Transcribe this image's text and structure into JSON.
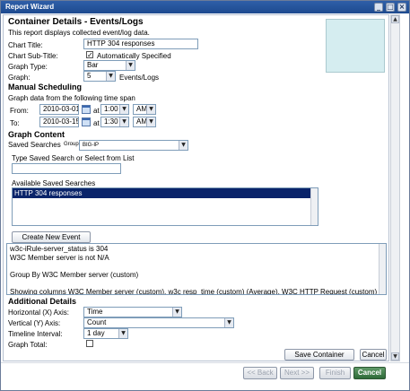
{
  "window": {
    "title": "Report Wizard"
  },
  "container": {
    "heading": "Container Details - Events/Logs",
    "description": "This report displays collected event/log data.",
    "chart_title_label": "Chart Title:",
    "chart_title_value": "HTTP 304 responses",
    "chart_subtitle_label": "Chart Sub-Title:",
    "auto_specified_label": "Automatically Specified",
    "graph_type_label": "Graph Type:",
    "graph_type_value": "Bar",
    "graph_label": "Graph:",
    "graph_value": "5",
    "graph_unit": "Events/Logs"
  },
  "scheduling": {
    "heading": "Manual Scheduling",
    "description": "Graph data from the following time span",
    "from_label": "From:",
    "from_date": "2010-03-01",
    "from_at": "at",
    "from_time": "1:00",
    "from_ampm": "AM",
    "to_label": "To:",
    "to_date": "2010-03-15",
    "to_at": "at",
    "to_time": "1:30",
    "to_ampm": "AM"
  },
  "graph_content": {
    "heading": "Graph Content",
    "saved_searches_label": "Saved Searches",
    "group_label": "Group:",
    "group_value": "BIG-IP",
    "type_search_label": "Type Saved Search or Select from List",
    "type_search_value": "",
    "available_label": "Available Saved Searches",
    "available_items": [
      "HTTP 304 responses"
    ],
    "create_button": "Create New Event Search",
    "query_lines": [
      "w3c-iRule-server_status is 304",
      "W3C Member server is not N/A",
      "",
      "Group By W3C Member server (custom)",
      "",
      "Showing columns W3C Member server (custom), w3c resp_time (custom) (Average), W3C HTTP Request (custom) (Unique"
    ]
  },
  "additional": {
    "heading": "Additional Details",
    "horizontal_label": "Horizontal (X) Axis:",
    "horizontal_value": "Time",
    "vertical_label": "Vertical (Y) Axis:",
    "vertical_value": "Count",
    "timeline_label": "Timeline Interval:",
    "timeline_value": "1 day",
    "graph_total_label": "Graph Total:"
  },
  "actions": {
    "save": "Save Container Details",
    "cancel_small": "Cancel"
  },
  "footer": {
    "back": "<< Back",
    "next": "Next >>",
    "finish": "Finish",
    "cancel": "Cancel"
  }
}
